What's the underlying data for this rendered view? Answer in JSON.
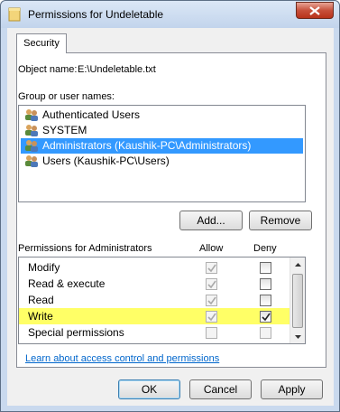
{
  "window": {
    "title": "Permissions for Undeletable"
  },
  "tabs": [
    {
      "label": "Security"
    }
  ],
  "object": {
    "label": "Object name:",
    "value": "E:\\Undeletable.txt"
  },
  "groups": {
    "label": "Group or user names:",
    "items": [
      {
        "label": "Authenticated Users",
        "selected": false
      },
      {
        "label": "SYSTEM",
        "selected": false
      },
      {
        "label": "Administrators (Kaushik-PC\\Administrators)",
        "selected": true
      },
      {
        "label": "Users (Kaushik-PC\\Users)",
        "selected": false
      }
    ],
    "add_label": "Add...",
    "remove_label": "Remove"
  },
  "permissions": {
    "label": "Permissions for Administrators",
    "allow_label": "Allow",
    "deny_label": "Deny",
    "rows": [
      {
        "label": "Modify",
        "allow": true,
        "allow_enabled": false,
        "deny": false,
        "deny_enabled": true,
        "highlight": false
      },
      {
        "label": "Read & execute",
        "allow": true,
        "allow_enabled": false,
        "deny": false,
        "deny_enabled": true,
        "highlight": false
      },
      {
        "label": "Read",
        "allow": true,
        "allow_enabled": false,
        "deny": false,
        "deny_enabled": true,
        "highlight": false
      },
      {
        "label": "Write",
        "allow": true,
        "allow_enabled": false,
        "deny": true,
        "deny_enabled": true,
        "highlight": true
      },
      {
        "label": "Special permissions",
        "allow": false,
        "allow_enabled": false,
        "deny": false,
        "deny_enabled": false,
        "highlight": false
      }
    ]
  },
  "link": {
    "label": "Learn about access control and permissions"
  },
  "buttons": {
    "ok": "OK",
    "cancel": "Cancel",
    "apply": "Apply"
  },
  "colors": {
    "selection": "#3399ff",
    "highlight": "#ffff66",
    "link": "#0066cc"
  },
  "icons": {
    "title": "folder-icon",
    "user": "users-group-icon",
    "close": "close-icon"
  }
}
